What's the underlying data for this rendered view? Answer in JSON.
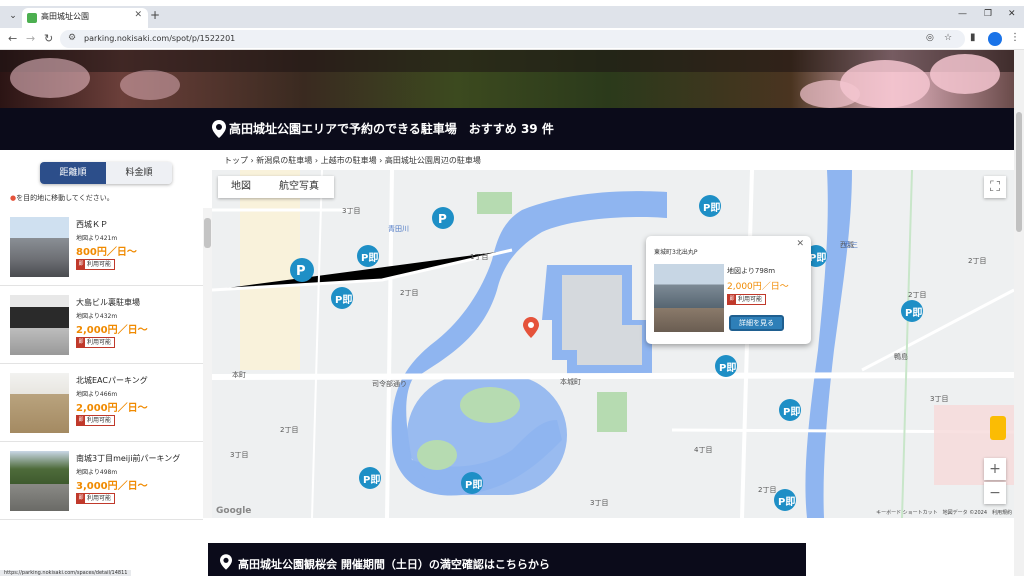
{
  "browser": {
    "tab_title": "高田城址公園",
    "url": "parking.nokisaki.com/spot/p/1522201"
  },
  "header": {
    "area_title": "高田城址公園エリアで予約のできる駐車場　おすすめ 39 件"
  },
  "sort": {
    "distance_label": "距離順",
    "price_label": "料金順"
  },
  "hint": "を目的地に移動してください。",
  "breadcrumb": "トップ › 新潟県の駐車場 › 上越市の駐車場 › 高田城址公園周辺の駐車場",
  "lots": [
    {
      "name": "西城ＫＰ",
      "distance": "地図より421m",
      "price": "800円／日〜",
      "badge": "利用可能"
    },
    {
      "name": "大島ビル裏駐車場",
      "distance": "地図より432m",
      "price": "2,000円／日〜",
      "badge": "利用可能"
    },
    {
      "name": "北城EACパーキング",
      "distance": "地図より466m",
      "price": "2,000円／日〜",
      "badge": "利用可能"
    },
    {
      "name": "南城3丁目meiji前パーキング",
      "distance": "地図より498m",
      "price": "3,000円／日〜",
      "badge": "利用可能"
    }
  ],
  "map": {
    "tab_map": "地図",
    "tab_aerial": "航空写真",
    "attribution": "キーボード ショートカット　地図データ ©2024　利用規約",
    "google": "Google",
    "labels": [
      "3丁目",
      "1丁目",
      "2丁目",
      "本城町",
      "司令部通り",
      "本町",
      "鴨島",
      "西城",
      "2丁目",
      "3丁目",
      "4丁目",
      "2丁目",
      "3丁目",
      "青田川",
      "西三",
      "2丁目",
      "3丁目",
      "2丁目"
    ],
    "popup": {
      "title": "東城町3北出丸P",
      "distance": "地図より798m",
      "price": "2,000円／日〜",
      "badge": "利用可能",
      "button": "詳細を見る"
    }
  },
  "bottom": {
    "title": "高田城址公園観桜会 開催期間（土日）の満空確認はこちらから"
  },
  "status_url": "https://parking.nokisaki.com/spaces/detail/14811",
  "colors": {
    "accent_blue": "#2c4e8a",
    "price_orange": "#f08a00",
    "badge_red": "#c0392b",
    "pin_blue": "#1e8fc6"
  }
}
